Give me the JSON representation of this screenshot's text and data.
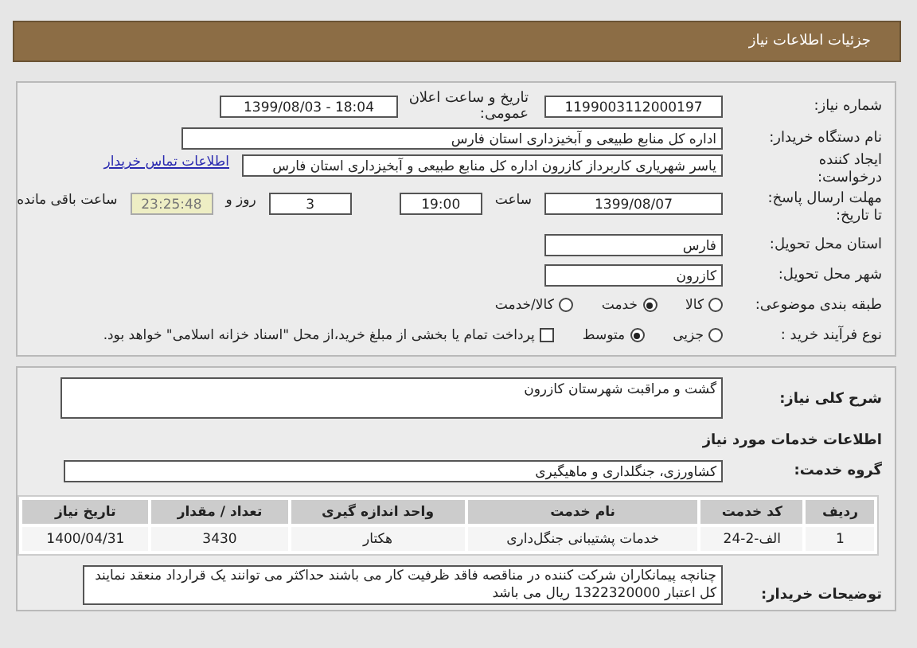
{
  "header": {
    "title": "جزئیات اطلاعات نیاز"
  },
  "need_info": {
    "need_number": {
      "label": "شماره نیاز:",
      "value": "1199003112000197"
    },
    "announce": {
      "label": "تاریخ و ساعت اعلان عمومی:",
      "value": "1399/08/03 - 18:04"
    },
    "buyer": {
      "label": "نام دستگاه خریدار:",
      "value": "اداره کل منابع طبیعی و آبخیزداری استان فارس"
    },
    "creator": {
      "label_lines": [
        "ایجاد کننده",
        "درخواست:"
      ],
      "value": "یاسر شهریاری کاربرداز کازرون اداره کل منابع طبیعی و آبخیزداری استان فارس",
      "link": "اطلاعات تماس خریدار"
    },
    "deadline": {
      "label_lines": [
        "مهلت ارسال پاسخ:",
        "تا تاریخ:"
      ],
      "date": "1399/08/07",
      "time_label": "ساعت",
      "time": "19:00",
      "days": "3",
      "days_label": "روز و",
      "remaining": "23:25:48",
      "remaining_label": "ساعت باقی مانده"
    },
    "province": {
      "label": "استان محل تحویل:",
      "value": "فارس"
    },
    "city": {
      "label": "شهر محل تحویل:",
      "value": "کازرون"
    },
    "category": {
      "label": "طبقه بندی موضوعی:",
      "options": [
        {
          "label": "کالا",
          "selected": false
        },
        {
          "label": "خدمت",
          "selected": true
        },
        {
          "label": "کالا/خدمت",
          "selected": false
        }
      ]
    },
    "process": {
      "label": "نوع فرآیند خرید :",
      "options": [
        {
          "label": "جزیی",
          "selected": false
        },
        {
          "label": "متوسط",
          "selected": true
        }
      ],
      "treasury": {
        "label": "پرداخت تمام یا بخشی از مبلغ خرید،از محل \"اسناد خزانه اسلامی\" خواهد بود.",
        "checked": false
      }
    }
  },
  "services": {
    "summary": {
      "label": "شرح کلی نیاز:",
      "value": "گشت و مراقبت شهرستان کازرون"
    },
    "heading": "اطلاعات خدمات مورد نیاز",
    "group": {
      "label": "گروه خدمت:",
      "value": "کشاورزی، جنگلداری و ماهیگیری"
    },
    "table": {
      "columns": [
        "ردیف",
        "کد خدمت",
        "نام خدمت",
        "واحد اندازه گیری",
        "تعداد / مقدار",
        "تاریخ نیاز"
      ],
      "rows": [
        [
          "1",
          "الف-2-24",
          "خدمات پشتیبانی جنگل‌داری",
          "هکتار",
          "3430",
          "1400/04/31"
        ]
      ]
    },
    "notes": {
      "label": "توضیحات خریدار:",
      "lines": [
        "چنانچه پیمانکاران شرکت کننده در مناقصه فاقد ظرفیت کار می باشند حداکثر می توانند یک قرارداد منعقد نمایند",
        "کل اعتبار 1322320000 ریال می باشد"
      ]
    }
  }
}
